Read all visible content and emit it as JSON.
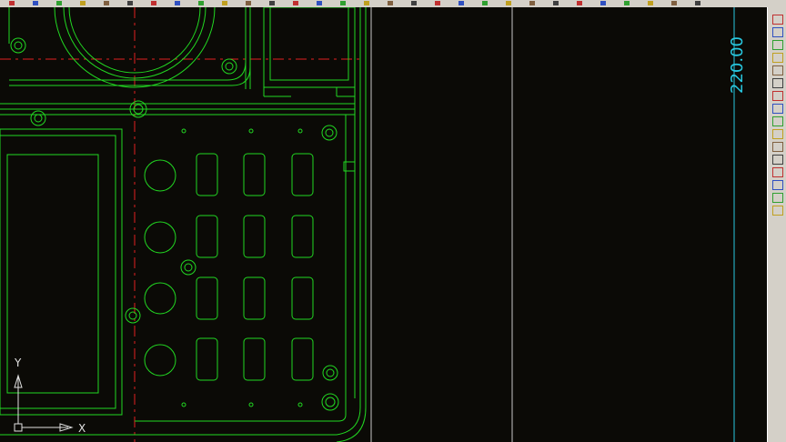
{
  "toolbar": {
    "top_icons": [
      "line-icon",
      "ray-icon",
      "arc-icon",
      "circle-icon",
      "rectangle-icon",
      "polygon-icon",
      "hatch-icon",
      "text-icon",
      "insert-icon",
      "block-icon",
      "zoom-icon",
      "pan-icon",
      "layer-icon",
      "properties-icon",
      "match-icon",
      "undo-icon",
      "redo-icon",
      "copy-icon",
      "paste-icon",
      "erase-icon",
      "move-icon",
      "rotate-icon",
      "scale-icon",
      "trim-icon",
      "extend-icon",
      "fillet-icon",
      "mirror-icon",
      "offset-icon",
      "array-icon",
      "explode-icon"
    ]
  },
  "side_toolbar": {
    "icons": [
      "erase-icon",
      "copy-icon",
      "mirror-icon",
      "offset-icon",
      "array-icon",
      "move-icon",
      "rotate-icon",
      "scale-icon",
      "stretch-icon",
      "trim-icon",
      "extend-icon",
      "break-icon",
      "join-icon",
      "chamfer-icon",
      "fillet-icon",
      "explode-icon"
    ]
  },
  "drawing": {
    "dimension_text": "220.00",
    "ucs_y_label": "Y",
    "ucs_x_label": "X",
    "colors": {
      "outline": "#22d822",
      "centerline": "#e02020",
      "dimension": "#28c8e0",
      "ucs": "#e0e0e0"
    }
  }
}
